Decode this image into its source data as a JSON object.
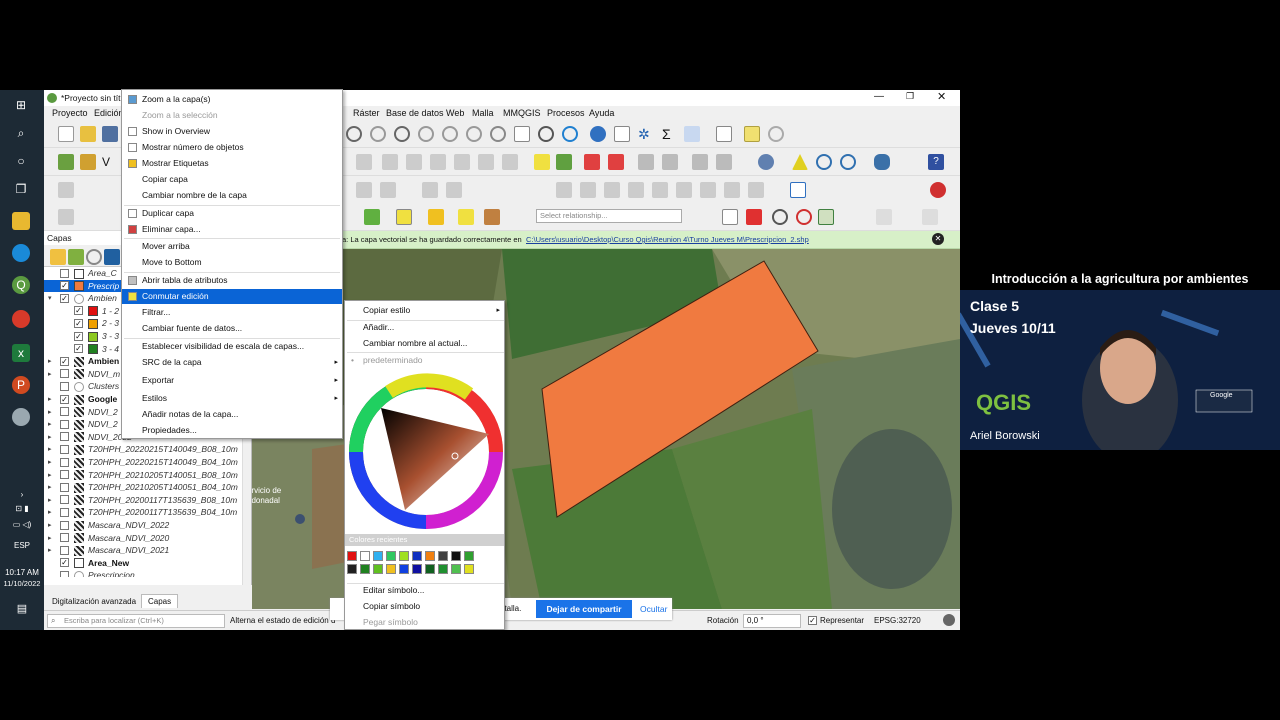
{
  "taskbar": {
    "lang": "ESP",
    "time": "10:17 AM",
    "date": "11/10/2022"
  },
  "window": {
    "title": "*Proyecto sin títu",
    "menus": [
      "Proyecto",
      "Edición",
      "Ráster",
      "Base de datos",
      "Web",
      "Malla",
      "MMQGIS",
      "Procesos",
      "Ayuda"
    ],
    "select_relationship_placeholder": "Select relationship..."
  },
  "message_bar": {
    "text": "a: La capa vectorial se ha guardado correctamente en",
    "link": "C:\\Users\\usuario\\Desktop\\Curso Qgis\\Reunion 4\\Turno Jueves M\\Prescripcion_2.shp"
  },
  "layers_panel": {
    "title": "Capas",
    "items": [
      {
        "label": "Area_C",
        "checked": false,
        "swatch": "#ffffff",
        "indent": 1
      },
      {
        "label": "Prescrip",
        "checked": true,
        "swatch": "#f07a40",
        "indent": 1,
        "selected": true
      },
      {
        "label": "Ambien",
        "checked": true,
        "indent": 1,
        "group": true
      },
      {
        "label": "1 - 2",
        "checked": true,
        "swatch": "#e01010",
        "indent": 2
      },
      {
        "label": "2 - 3",
        "checked": true,
        "swatch": "#f0a000",
        "indent": 2
      },
      {
        "label": "3 - 3",
        "checked": true,
        "swatch": "#8cc820",
        "indent": 2
      },
      {
        "label": "3 - 4",
        "checked": true,
        "swatch": "#208020",
        "indent": 2
      },
      {
        "label": "Ambien",
        "checked": true,
        "indent": 1,
        "raster": true,
        "bold": true
      },
      {
        "label": "NDVI_m",
        "checked": false,
        "indent": 1,
        "raster": true
      },
      {
        "label": "Clusters",
        "checked": false,
        "indent": 1
      },
      {
        "label": "Google",
        "checked": true,
        "indent": 1,
        "raster": true,
        "bold": true
      },
      {
        "label": "NDVI_2",
        "checked": false,
        "indent": 1,
        "raster": true
      },
      {
        "label": "NDVI_2",
        "checked": false,
        "indent": 1,
        "raster": true
      },
      {
        "label": "NDVI_2022",
        "checked": false,
        "indent": 1,
        "raster": true
      },
      {
        "label": "T20HPH_20220215T140049_B08_10m",
        "checked": false,
        "indent": 1,
        "raster": true
      },
      {
        "label": "T20HPH_20220215T140049_B04_10m",
        "checked": false,
        "indent": 1,
        "raster": true
      },
      {
        "label": "T20HPH_20210205T140051_B08_10m",
        "checked": false,
        "indent": 1,
        "raster": true
      },
      {
        "label": "T20HPH_20210205T140051_B04_10m",
        "checked": false,
        "indent": 1,
        "raster": true
      },
      {
        "label": "T20HPH_20200117T135639_B08_10m",
        "checked": false,
        "indent": 1,
        "raster": true
      },
      {
        "label": "T20HPH_20200117T135639_B04_10m",
        "checked": false,
        "indent": 1,
        "raster": true
      },
      {
        "label": "Mascara_NDVI_2022",
        "checked": false,
        "indent": 1,
        "raster": true
      },
      {
        "label": "Mascara_NDVI_2020",
        "checked": false,
        "indent": 1,
        "raster": true
      },
      {
        "label": "Mascara_NDVI_2021",
        "checked": false,
        "indent": 1,
        "raster": true
      },
      {
        "label": "Area_New",
        "checked": true,
        "swatch": "#ffffff",
        "indent": 1,
        "bold": true,
        "plain": true
      },
      {
        "label": "Prescripcion",
        "checked": false,
        "indent": 1
      }
    ],
    "tabs": [
      "Digitalización avanzada",
      "Capas"
    ],
    "locator_placeholder": "Escriba para localizar (Ctrl+K)"
  },
  "context_menu": {
    "items": [
      {
        "label": "Zoom a la capa(s)",
        "disabled": false
      },
      {
        "label": "Zoom a la selección",
        "disabled": true
      },
      {
        "label": "Show in Overview",
        "disabled": false
      },
      {
        "label": "Mostrar número de objetos",
        "disabled": false
      },
      {
        "label": "Mostrar Etiquetas",
        "disabled": false
      },
      {
        "label": "Copiar capa",
        "disabled": false
      },
      {
        "label": "Cambiar nombre de la capa",
        "disabled": false
      },
      {
        "label": "Duplicar capa",
        "disabled": false
      },
      {
        "label": "Eliminar capa...",
        "disabled": false
      },
      {
        "label": "Mover arriba",
        "disabled": false
      },
      {
        "label": "Move to Bottom",
        "disabled": false
      },
      {
        "label": "Abrir tabla de atributos",
        "disabled": false
      },
      {
        "label": "Conmutar edición",
        "disabled": false,
        "highlighted": true
      },
      {
        "label": "Filtrar...",
        "disabled": false
      },
      {
        "label": "Cambiar fuente de datos...",
        "disabled": false
      },
      {
        "label": "Establecer visibilidad de escala de capas...",
        "disabled": false
      },
      {
        "label": "SRC de la capa",
        "disabled": false,
        "submenu": true
      },
      {
        "label": "Exportar",
        "disabled": false,
        "submenu": true
      },
      {
        "label": "Estilos",
        "disabled": false,
        "submenu": true
      },
      {
        "label": "Añadir notas de la capa...",
        "disabled": false
      },
      {
        "label": "Propiedades...",
        "disabled": false
      }
    ]
  },
  "style_submenu": {
    "copy_style": "Copiar estilo",
    "add": "Añadir...",
    "rename": "Cambiar nombre al actual...",
    "default": "predeterminado",
    "recent_colors": "Colores recientes",
    "edit_symbol": "Editar símbolo...",
    "copy_symbol": "Copiar símbolo",
    "paste_symbol": "Pegar símbolo",
    "colors_row1": [
      "#e01010",
      "#ffffff",
      "#30b0f0",
      "#30c860",
      "#a0e020",
      "#1030c0",
      "#f08010",
      "#404040",
      "#101010",
      "#30a030"
    ],
    "colors_row2": [
      "#202020",
      "#208020",
      "#60c020",
      "#f0c020",
      "#1040e0",
      "#1010a0",
      "#106020",
      "#209030",
      "#50c050",
      "#e0e020"
    ]
  },
  "share_bar": {
    "text": "ntalla.",
    "stop": "Dejar de compartir",
    "hide": "Ocultar"
  },
  "status": {
    "left": "Alterna el estado de edición d",
    "rotation_label": "Rotación",
    "rotation_value": "0,0 °",
    "render_label": "Representar",
    "crs": "EPSG:32720"
  },
  "video": {
    "title": "Introducción a la agricultura por ambientes",
    "class": "Clase 5",
    "date": "Jueves 10/11",
    "logo": "QGIS",
    "presenter": "Ariel Borowski",
    "google_badge": "Google"
  },
  "colors": {
    "selection": "#0a64d6",
    "field": "#f07a40",
    "msgbar": "#d7f0c8"
  }
}
